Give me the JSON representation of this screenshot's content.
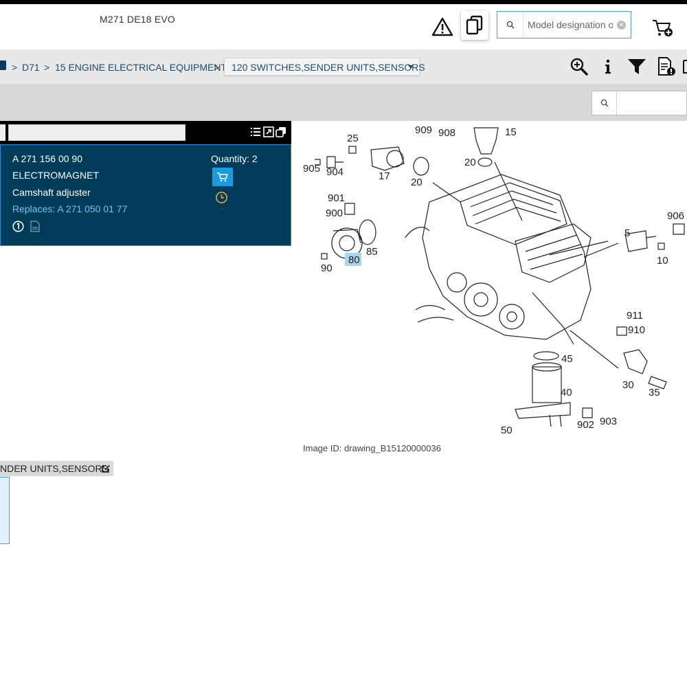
{
  "header": {
    "model_title": "M271 DE18 EVO",
    "model_search_placeholder": "Model designation o"
  },
  "breadcrumb": {
    "items": [
      "D71",
      "15 ENGINE ELECTRICAL EQUIPMENT"
    ],
    "separator": ">",
    "current_dropdown": "120 SWITCHES,SENDER UNITS,SENSORS"
  },
  "toolbar": {
    "icons": [
      "zoom-in-icon",
      "info-icon",
      "filter-icon",
      "document-alert-icon"
    ]
  },
  "part": {
    "number": "A 271 156 00 90",
    "name": "ELECTROMAGNET",
    "description": "Camshaft adjuster",
    "replaces": "Replaces: A 271 050 01 77",
    "quantity": "Quantity: 2"
  },
  "drawing": {
    "image_id": "Image ID: drawing_B15120000036",
    "highlighted_callout": "80",
    "callouts": [
      "909",
      "908",
      "15",
      "25",
      "20",
      "905",
      "904",
      "17",
      "20",
      "901",
      "900",
      "85",
      "80",
      "90",
      "906",
      "5",
      "10",
      "911",
      "910",
      "45",
      "40",
      "30",
      "35",
      "50",
      "902",
      "903"
    ]
  },
  "section": {
    "label": "NDER UNITS,SENSORS"
  },
  "colors": {
    "panel_bg": "#003c5a",
    "accent_blue": "#1a9be0",
    "replace_link": "#6cc6f0",
    "highlight": "#a8d8ee"
  }
}
